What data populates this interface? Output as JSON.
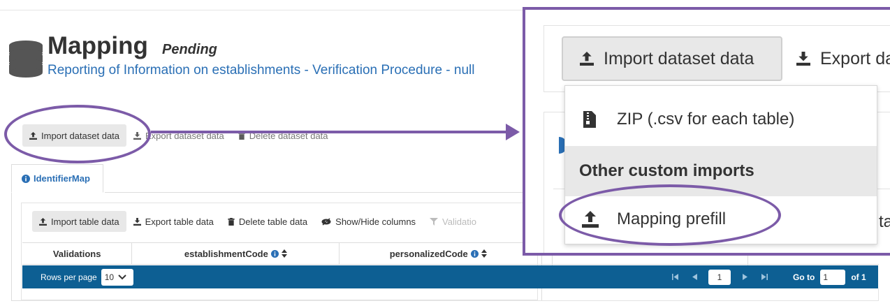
{
  "header": {
    "title": "Mapping",
    "status": "Pending",
    "subtitle": "Reporting of Information on establishments - Verification Procedure - null"
  },
  "dataset_toolbar": {
    "import_label": "Import dataset data",
    "export_label": "Export dataset data",
    "delete_label": "Delete dataset data"
  },
  "tab": {
    "label": "IdentifierMap"
  },
  "table_toolbar": {
    "import_label": "Import table data",
    "export_label": "Export table data",
    "delete_label": "Delete table data",
    "show_hide_label": "Show/Hide columns",
    "validations_label": "Validatio"
  },
  "table": {
    "columns": [
      "Validations",
      "establishmentCode",
      "personalizedCode"
    ]
  },
  "pager": {
    "rows_per_page_label": "Rows per page",
    "rows_per_page_value": "10",
    "current_page": "1",
    "goto_label": "Go to",
    "goto_value": "1",
    "of_label": "of 1"
  },
  "zoom": {
    "import_label": "Import dataset data",
    "export_label": "Export da",
    "menu": {
      "zip_label": "ZIP (.csv for each table)",
      "section_header": "Other custom imports",
      "prefill_label": "Mapping prefill"
    },
    "partial_text": "ta"
  },
  "colors": {
    "accent": "#7c5ba8",
    "link": "#2a6fb5",
    "pager_bg": "#0d5f93"
  }
}
